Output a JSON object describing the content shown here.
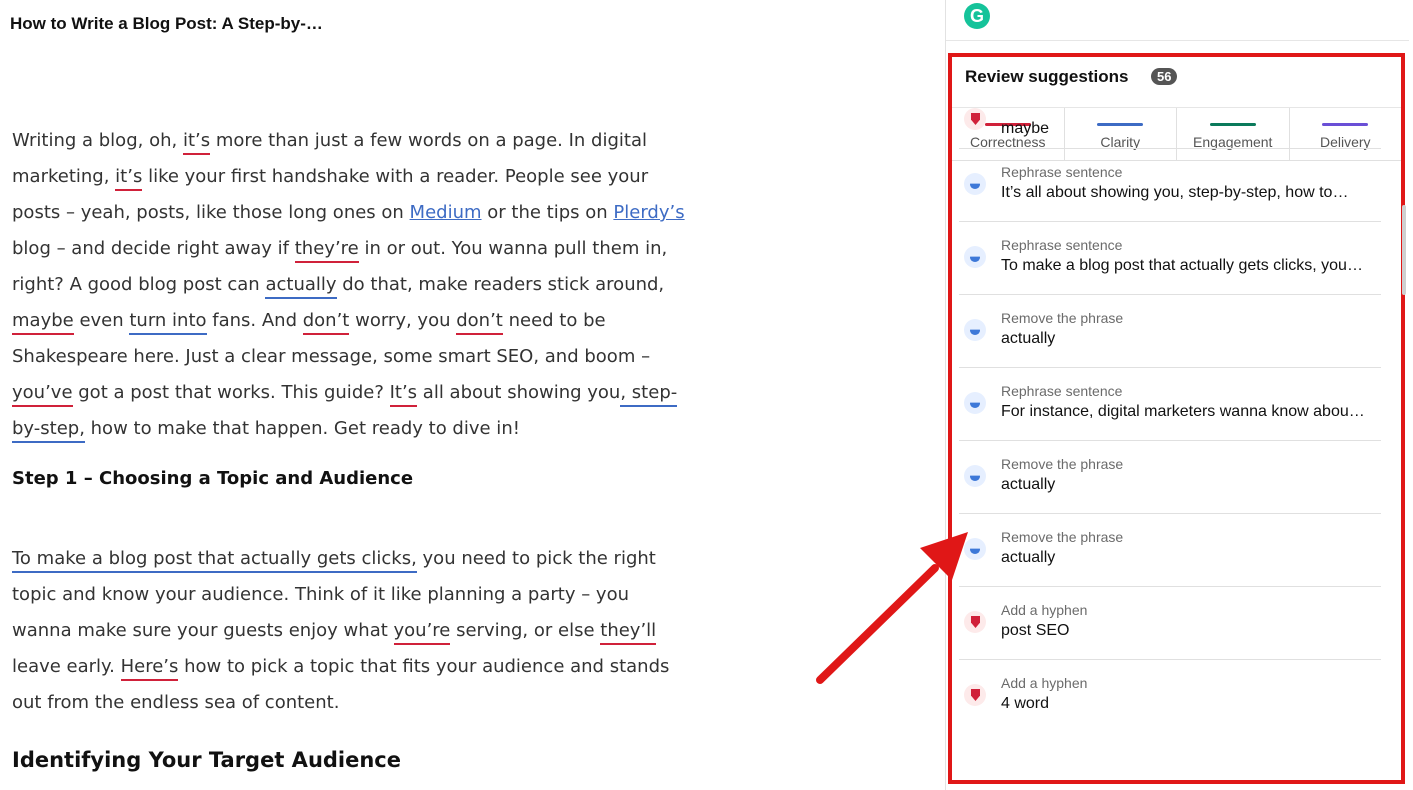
{
  "doc": {
    "title": "How to Write a Blog Post: A Step-by-…",
    "p1": {
      "t1": "Writing a blog, oh, ",
      "u1": "it’s",
      "t2": " more than just a few words on a page. In digital marketing, ",
      "u2": "it’s",
      "t3": " like your first handshake with a reader. People see your posts – yeah, posts, like those long ones on ",
      "link1": "Medium",
      "t4": " or the tips on ",
      "link2": "Plerdy’s",
      "t5": " blog – and decide right away if ",
      "u3": "they’re",
      "t6": " in or out. You wanna pull them in, right? A good blog post can ",
      "b1": "actually",
      "t7": " do that, make readers stick around, ",
      "u4": "maybe",
      "t8": " even ",
      "b2": "turn into",
      "t9": " fans. And ",
      "u5": "don’t",
      "t10": " worry, you ",
      "u6": "don’t",
      "t11": " need to be Shakespeare here. Just a clear message, some smart SEO, and boom – ",
      "u7": "you’ve",
      "t12": " got a post that works. This guide? ",
      "u8": "It’s",
      "t13": " all about showing you",
      "b3": ", step-by-step,",
      "t14": " how to make that happen. Get ready to dive in!"
    },
    "h2": "Step 1 – Choosing a Topic and Audience",
    "p2": {
      "b1": "To make a blog post that actually gets clicks,",
      "t1": " you need to pick the right topic and know your audience. Think of it like planning a party – you wanna make sure your guests enjoy what ",
      "u1": "you’re",
      "t2": " serving, or else ",
      "u2": "they’ll",
      "t3": " leave early. ",
      "u3": "Here’s",
      "t4": " how to pick a topic that fits your audience and stands out from the endless sea of content."
    },
    "h3": "Identifying Your Target Audience"
  },
  "panel": {
    "logo": "G",
    "title": "Review suggestions",
    "count": "56",
    "tabs": [
      {
        "label": "Correctness",
        "color": "#d0213a"
      },
      {
        "label": "Clarity",
        "color": "#3d6bc4"
      },
      {
        "label": "Engagement",
        "color": "#0b7a5b"
      },
      {
        "label": "Delivery",
        "color": "#6a4fd6"
      }
    ],
    "cards": [
      {
        "icon": "correctness-icon",
        "type": "",
        "text": "maybe"
      },
      {
        "icon": "clarity-icon",
        "type": "Rephrase sentence",
        "text": "It’s all about showing you, step-by-step, how to…"
      },
      {
        "icon": "clarity-icon",
        "type": "Rephrase sentence",
        "text": "To make a blog post that actually gets clicks, you…"
      },
      {
        "icon": "clarity-icon",
        "type": "Remove the phrase",
        "text": "actually"
      },
      {
        "icon": "clarity-icon",
        "type": "Rephrase sentence",
        "text": "For instance, digital marketers wanna know abou…"
      },
      {
        "icon": "clarity-icon",
        "type": "Remove the phrase",
        "text": "actually"
      },
      {
        "icon": "clarity-icon",
        "type": "Remove the phrase",
        "text": "actually"
      },
      {
        "icon": "correctness-icon",
        "type": "Add a hyphen",
        "text": "post SEO"
      },
      {
        "icon": "correctness-icon",
        "type": "Add a hyphen",
        "text": "4 word"
      }
    ]
  },
  "colors": {
    "highlight": "#e01717",
    "red_underline": "#d0213a",
    "blue_underline": "#3d6bc4"
  }
}
